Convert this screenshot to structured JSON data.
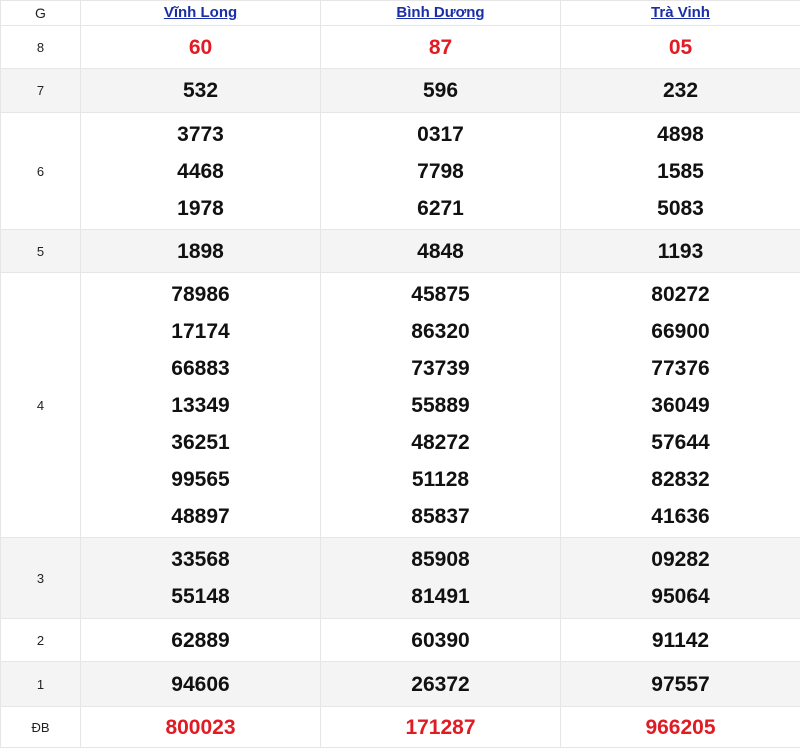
{
  "header": {
    "g_label": "G",
    "provinces": [
      "Vĩnh Long",
      "Bình Dương",
      "Trà Vinh"
    ]
  },
  "rows": {
    "g8": {
      "label": "8",
      "values": [
        [
          "60"
        ],
        [
          "87"
        ],
        [
          "05"
        ]
      ]
    },
    "g7": {
      "label": "7",
      "values": [
        [
          "532"
        ],
        [
          "596"
        ],
        [
          "232"
        ]
      ]
    },
    "g6": {
      "label": "6",
      "values": [
        [
          "3773",
          "4468",
          "1978"
        ],
        [
          "0317",
          "7798",
          "6271"
        ],
        [
          "4898",
          "1585",
          "5083"
        ]
      ]
    },
    "g5": {
      "label": "5",
      "values": [
        [
          "1898"
        ],
        [
          "4848"
        ],
        [
          "1193"
        ]
      ]
    },
    "g4": {
      "label": "4",
      "values": [
        [
          "78986",
          "17174",
          "66883",
          "13349",
          "36251",
          "99565",
          "48897"
        ],
        [
          "45875",
          "86320",
          "73739",
          "55889",
          "48272",
          "51128",
          "85837"
        ],
        [
          "80272",
          "66900",
          "77376",
          "36049",
          "57644",
          "82832",
          "41636"
        ]
      ]
    },
    "g3": {
      "label": "3",
      "values": [
        [
          "33568",
          "55148"
        ],
        [
          "85908",
          "81491"
        ],
        [
          "09282",
          "95064"
        ]
      ]
    },
    "g2": {
      "label": "2",
      "values": [
        [
          "62889"
        ],
        [
          "60390"
        ],
        [
          "91142"
        ]
      ]
    },
    "g1": {
      "label": "1",
      "values": [
        [
          "94606"
        ],
        [
          "26372"
        ],
        [
          "97557"
        ]
      ]
    },
    "db": {
      "label": "ĐB",
      "values": [
        [
          "800023"
        ],
        [
          "171287"
        ],
        [
          "966205"
        ]
      ]
    }
  },
  "colors": {
    "special_number": "#e01b24",
    "header_link": "#1a2ea8"
  }
}
